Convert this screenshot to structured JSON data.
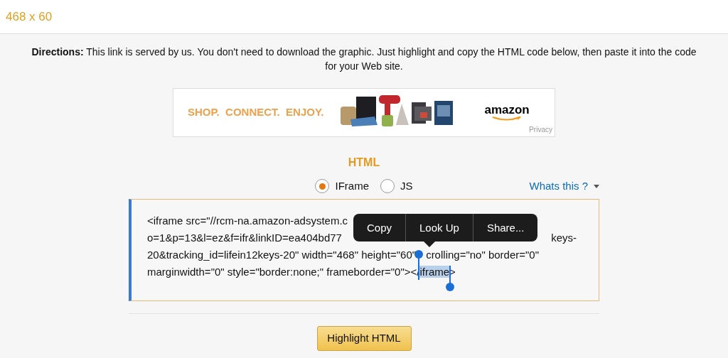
{
  "header": {
    "title": "468 x 60"
  },
  "directions": "**Directions:** This link is served by us. You don't need to download the graphic. Just highlight and copy the HTML code below, then paste it into the code for your Web site.",
  "banner": {
    "slogan": "SHOP.  CONNECT.  ENJOY.",
    "logo": "amazon",
    "privacy": "Privacy"
  },
  "section_title": "HTML",
  "radios": [
    {
      "label": "IFrame",
      "selected": true
    },
    {
      "label": "JS",
      "selected": false
    }
  ],
  "help_link": "Whats this ?",
  "code_lines": [
    {
      "kind": "split",
      "head": "<iframe src=\"//rcm-na.amazon-adsystem.c"
    },
    {
      "kind": "split",
      "head": "o=1&p=13&l=ez&f=ifr&linkID=ea404bd77",
      "tail": "keys-"
    },
    {
      "kind": "gap",
      "head": "20&tracking_id=lifein12keys-20\" width=\"468\" height=\"60\"",
      "tail": "crolling=\"no\" border=\"0\""
    },
    {
      "kind": "gap",
      "head": "marginwidth=\"0\" style=\"border:none;\" frameborder=\"0\"></",
      "selection": "iframe",
      "after": ">"
    }
  ],
  "context_menu": [
    "Copy",
    "Look Up",
    "Share..."
  ],
  "button": "Highlight HTML"
}
